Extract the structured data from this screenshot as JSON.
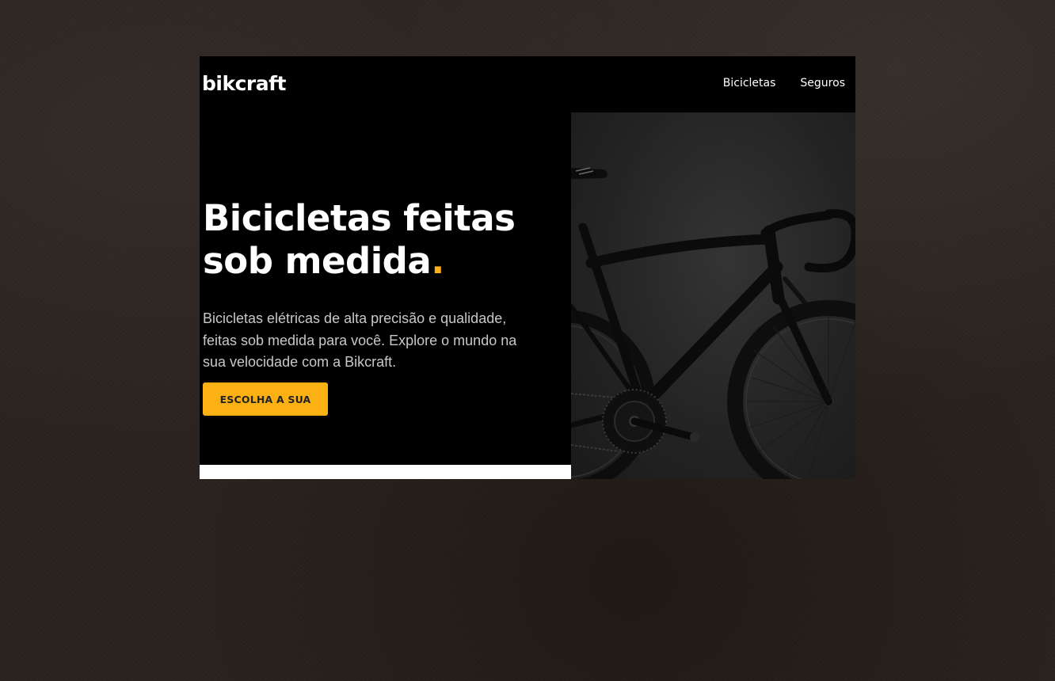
{
  "header": {
    "logo": "bikcraft",
    "nav": [
      {
        "label": "Bicicletas"
      },
      {
        "label": "Seguros"
      }
    ]
  },
  "hero": {
    "title_text": "Bicicletas feitas sob medida",
    "title_dot": ".",
    "description": "Bicicletas elétricas de alta precisão e qualidade, feitas sob medida para você. Explore o mundo na sua velocidade com a Bikcraft.",
    "cta_label": "ESCOLHA A SUA",
    "image": "black-road-bicycle-photo"
  },
  "colors": {
    "accent": "#fbb013",
    "site_background": "#000000",
    "page_background": "#2a221e"
  }
}
